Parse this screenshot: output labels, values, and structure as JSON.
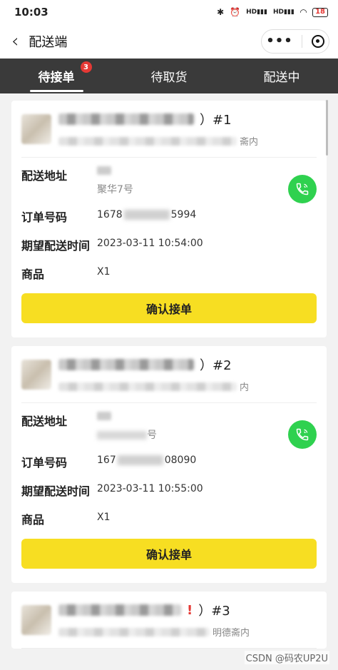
{
  "status_bar": {
    "time": "10:03",
    "signal_label_1": "HD",
    "signal_label_2": "HD",
    "battery": "18"
  },
  "nav": {
    "title": "配送端",
    "more_icon": "ellipsis-icon",
    "close_icon": "target-icon"
  },
  "tabs": [
    {
      "label": "待接单",
      "badge": "3",
      "active": true
    },
    {
      "label": "待取货"
    },
    {
      "label": "配送中"
    }
  ],
  "labels": {
    "address": "配送地址",
    "order_no": "订单号码",
    "expected_time": "期望配送时间",
    "goods": "商品",
    "confirm": "确认接单"
  },
  "orders": [
    {
      "seq": "）#1",
      "addr_tail": "斋内",
      "address_line2": "聚华7号",
      "order_prefix": "1678",
      "order_suffix": "5994",
      "expected_time": "2023-03-11 10:54:00",
      "goods": "X1"
    },
    {
      "seq": "）#2",
      "addr_tail": "内",
      "address_line2": "号",
      "order_prefix": "167",
      "order_suffix": "08090",
      "expected_time": "2023-03-11 10:55:00",
      "goods": "X1"
    },
    {
      "seq": "）#3",
      "addr_tail": "明德斋内"
    }
  ],
  "watermark": "CSDN @码农UP2U",
  "colors": {
    "tab_bg": "#3a3a3a",
    "confirm_bg": "#f7de22",
    "phone_bg": "#2fd14f",
    "badge_bg": "#e53935"
  }
}
